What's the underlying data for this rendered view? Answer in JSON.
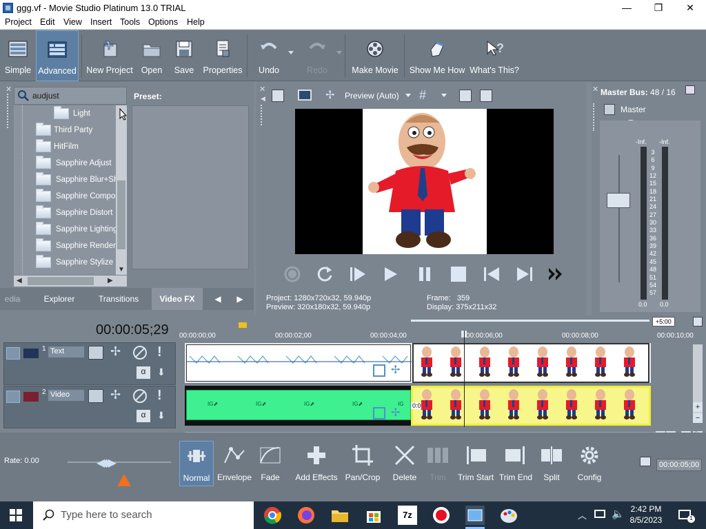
{
  "window": {
    "title": "ggg.vf - Movie Studio Platinum 13.0 TRIAL",
    "minimize": "—",
    "maximize": "❐",
    "close": "✕"
  },
  "menu": [
    "Project",
    "Edit",
    "View",
    "Insert",
    "Tools",
    "Options",
    "Help"
  ],
  "toolbar": {
    "simple": "Simple",
    "advanced": "Advanced",
    "new_project": "New Project",
    "open": "Open",
    "save": "Save",
    "properties": "Properties",
    "undo": "Undo",
    "redo": "Redo",
    "make_movie": "Make Movie",
    "show_me_how": "Show Me How",
    "whats_this": "What's This?"
  },
  "explorer": {
    "search_value": "audjust",
    "preset_label": "Preset:",
    "tree": [
      "Light",
      "Third Party",
      "HitFilm",
      "Sapphire Adjust",
      "Sapphire Blur+Sha",
      "Sapphire Composi",
      "Sapphire Distort",
      "Sapphire Lighting",
      "Sapphire Render",
      "Sapphire Stylize"
    ],
    "tabs": [
      "edia",
      "Explorer",
      "Transitions",
      "Video FX"
    ]
  },
  "preview": {
    "mode": "Preview (Auto)",
    "project_label": "Project:",
    "project_value": "1280x720x32, 59.940p",
    "preview_label": "Preview:",
    "preview_value": "320x180x32, 59.940p",
    "frame_label": "Frame:",
    "frame_value": "359",
    "display_label": "Display:",
    "display_value": "375x211x32"
  },
  "master": {
    "title": "Master Bus:",
    "bus_value": "48 / 16",
    "label": "Master",
    "inf_left": "-Inf.",
    "inf_right": "-Inf.",
    "scale": [
      "3",
      "6",
      "9",
      "12",
      "15",
      "18",
      "21",
      "24",
      "27",
      "30",
      "33",
      "36",
      "39",
      "42",
      "45",
      "48",
      "51",
      "54",
      "57"
    ],
    "bottom_left": "0.0",
    "bottom_right": "0.0"
  },
  "timeline": {
    "timecode": "00:00:05;29",
    "rate": "Rate: 0.00",
    "tracks": [
      {
        "number": "1",
        "name": "Text"
      },
      {
        "number": "2",
        "name": "Video"
      }
    ],
    "ruler": [
      "00:00:00;00",
      "00:00:02;00",
      "00:00:04;00",
      "00:00:06;00",
      "00:00:08;00",
      "00:00:10;00"
    ],
    "offset_badge": "+5:00",
    "event_time": "0:09",
    "end_time": "00:00:05;00"
  },
  "edit_tools": {
    "normal": "Normal",
    "envelope": "Envelope",
    "fade": "Fade",
    "add_effects": "Add Effects",
    "pan_crop": "Pan/Crop",
    "delete": "Delete",
    "trim": "Trim",
    "trim_start": "Trim Start",
    "trim_end": "Trim End",
    "split": "Split",
    "config": "Config"
  },
  "taskbar": {
    "search_placeholder": "Type here to search",
    "time": "2:42 PM",
    "date": "8/5/2023"
  }
}
